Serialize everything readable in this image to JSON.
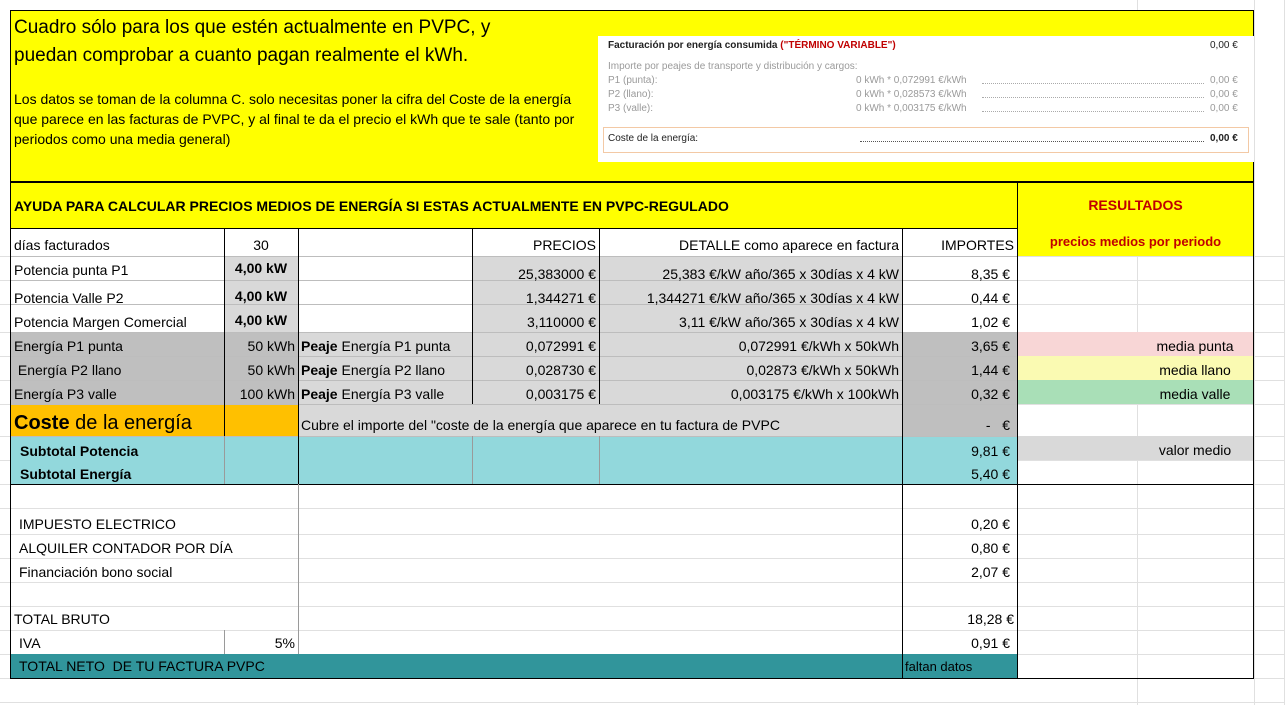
{
  "header": {
    "title_line1": "Cuadro sólo para los que estén actualmente en PVPC, y",
    "title_line2": "puedan comprobar a cuanto pagan realmente el kWh.",
    "desc_line1": "Los datos se toman de la columna C. solo necesitas poner la cifra del Coste de la energía",
    "desc_line2": "que parece en las facturas de PVPC, y al final te da el precio el kWh que te sale (tanto por",
    "desc_line3": "periodos como una media general)"
  },
  "invoice": {
    "title": "Facturación por energía consumida",
    "title_red": "(\"TÉRMINO VARIABLE\")",
    "title_amount": "0,00 €",
    "sub_label": "Importe por peajes de transporte y distribución y cargos:",
    "rows": [
      {
        "label": "P1 (punta):",
        "detail": "0 kWh * 0,072991 €/kWh",
        "amount": "0,00 €"
      },
      {
        "label": "P2 (llano):",
        "detail": "0 kWh * 0,028573 €/kWh",
        "amount": "0,00 €"
      },
      {
        "label": "P3 (valle):",
        "detail": "0 kWh * 0,003175 €/kWh",
        "amount": "0,00 €"
      }
    ],
    "cost_label": "Coste de la energía:",
    "cost_amount": "0,00 €"
  },
  "help_title": "AYUDA PARA CALCULAR PRECIOS MEDIOS DE ENERGÍA SI ESTAS ACTUALMENTE EN PVPC-REGULADO",
  "results": {
    "title": "RESULTADOS",
    "subtitle": "precios medios por periodo",
    "media_punta": "media punta",
    "media_llano": "media llano",
    "media_valle": "media valle",
    "valor_medio": "valor medio"
  },
  "colors": {
    "yellow": "#ffff00",
    "gray_dark": "#bfbfbf",
    "gray_light": "#d9d9d9",
    "orange": "#ffc000",
    "teal_light": "#92d8dc",
    "teal_dark": "#31959b",
    "pink": "#f8d6d6",
    "light_yellow": "#fafab2",
    "green": "#a9dfb7",
    "red_text": "#c00000"
  },
  "table": {
    "dias_label": "días facturados",
    "dias_value": "30",
    "h_precios": "PRECIOS",
    "h_detalle": "DETALLE como aparece en factura",
    "h_importes": "IMPORTES",
    "potencia": [
      {
        "label": "Potencia punta P1",
        "kw": "4,00 kW",
        "precio": "25,383000 €",
        "detalle": "25,383 €/kW año/365 x 30días x 4 kW",
        "importe": "8,35 €"
      },
      {
        "label": "Potencia Valle P2",
        "kw": "4,00 kW",
        "precio": "1,344271 €",
        "detalle": "1,344271 €/kW año/365 x 30días x 4 kW",
        "importe": "0,44 €"
      },
      {
        "label": "Potencia Margen Comercial",
        "kw": "4,00 kW",
        "precio": "3,110000 €",
        "detalle": "3,11 €/kW año/365 x 30días x 4 kW",
        "importe": "1,02 €"
      }
    ],
    "peaje_word": "Peaje",
    "energia": [
      {
        "label": "Energía P1 punta",
        "kwh": "50 kWh",
        "peaje_rest": " Energía P1 punta",
        "precio": "0,072991 €",
        "detalle": "0,072991 €/kWh x 50kWh",
        "importe": "3,65 €"
      },
      {
        "label": " Energía P2 llano",
        "kwh": "50 kWh",
        "peaje_rest": " Energía P2 llano",
        "precio": "0,028730 €",
        "detalle": "0,02873 €/kWh x 50kWh",
        "importe": "1,44 €"
      },
      {
        "label": "Energía P3 valle",
        "kwh": "100 kWh",
        "peaje_rest": " Energía P3 valle",
        "precio": "0,003175 €",
        "detalle": "0,003175 €/kWh x 100kWh",
        "importe": "0,32 €"
      }
    ],
    "coste_bold": "Coste",
    "coste_rest": " de la energía",
    "coste_note": "Cubre el importe del \"coste de la energía que aparece en tu factura de PVPC",
    "coste_importe": "-   €",
    "subtotal_potencia": "Subtotal Potencia",
    "subtotal_potencia_value": "9,81 €",
    "subtotal_energia": "Subtotal Energía",
    "subtotal_energia_value": "5,40 €",
    "impuesto_label": "IMPUESTO ELECTRICO",
    "impuesto_value": "0,20 €",
    "alquiler_label": "ALQUILER CONTADOR POR DÍA",
    "alquiler_value": "0,80 €",
    "bono_label": "Financiación bono social",
    "bono_value": "2,07 €",
    "total_bruto_label": "TOTAL BRUTO",
    "total_bruto_value": "18,28 €",
    "iva_label": "IVA",
    "iva_pct": "5%",
    "iva_value": "0,91 €",
    "total_neto_label": "TOTAL NETO  DE TU FACTURA PVPC",
    "total_neto_value": "faltan datos"
  }
}
